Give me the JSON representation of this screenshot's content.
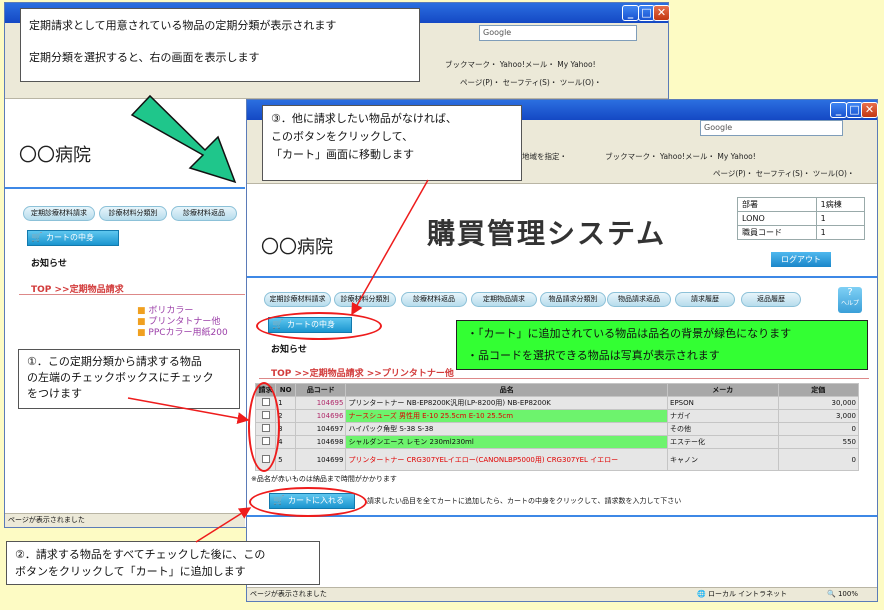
{
  "notes": {
    "top_line1": "定期請求として用意されている物品の定期分類が表示されます",
    "top_line2": "定期分類を選択すると、右の画面を表示します",
    "step3_line1": "③．他に請求したい物品がなければ、",
    "step3_line2": "このボタンをクリックして、",
    "step3_line3": "「カート」画面に移動します",
    "step1_line1": "①．この定期分類から請求する物品",
    "step1_line2": "の左端のチェックボックスにチェック",
    "step1_line3": "をつけます",
    "step2_line1": "②．請求する物品をすべてチェックした後に、この",
    "step2_line2": "ボタンをクリックして「カート」に追加します",
    "green_line1": "・「カート」に追加されている物品は品名の背景が緑色になります",
    "green_line2": "・品コードを選択できる物品は写真が表示されます"
  },
  "back_window": {
    "google": "Google",
    "bookmarks": "ブックマーク・",
    "yahoo_mail": "Yahoo!メール・",
    "my_yahoo": "My Yahoo!",
    "tools": "ページ(P)・ セーフティ(S)・ ツール(O)・",
    "hospital": "〇〇病院",
    "nav": [
      "定期診療材料請求",
      "診療材料分類別",
      "診療材料返品"
    ],
    "cart_label": "カートの中身",
    "notice": "お知らせ",
    "breadcrumb": "TOP >>定期物品請求",
    "categories": [
      "ボリカラー",
      "プリンタトナー他",
      "PPCカラー用紙200"
    ],
    "status": "ページが表示されました"
  },
  "front_window": {
    "google": "Google",
    "tools_row1": "地域を指定・",
    "bookmarks": "ブックマーク・",
    "yahoo_mail": "Yahoo!メール・",
    "my_yahoo": "My Yahoo!",
    "tools_row2": "ページ(P)・ セーフティ(S)・ ツール(O)・",
    "hospital": "〇〇病院",
    "system_title": "購買管理システム",
    "info": [
      {
        "label": "部署",
        "value": "1病棟"
      },
      {
        "label": "LONO",
        "value": "1"
      },
      {
        "label": "職員コード",
        "value": "1"
      }
    ],
    "logout": "ログアウト",
    "nav": [
      "定期診療材料請求",
      "診療材料分類別",
      "診療材料返品",
      "定期物品請求",
      "物品請求分類別",
      "物品請求返品",
      "請求履歴",
      "返品履歴"
    ],
    "help": "ヘルプ",
    "cart_label": "カートの中身",
    "notice": "お知らせ",
    "breadcrumb": "TOP >>定期物品請求 >>プリンタトナー他",
    "table_headers": [
      "請求",
      "NO",
      "品コード",
      "品名",
      "メーカ",
      "定価"
    ],
    "rows": [
      {
        "no": "1",
        "code": "104695",
        "name": "プリンタートナー NB-EP8200K汎用(LP-8200用) NB-EP8200K",
        "maker": "EPSON",
        "price": "30,000"
      },
      {
        "no": "2",
        "code": "104696",
        "name": "ナースシューズ 男性用 E-10 25.5cm E-10 25.5cm",
        "maker": "ナガイ",
        "price": "3,000"
      },
      {
        "no": "3",
        "code": "104697",
        "name": "ハイパック角型 S-38 S-38",
        "maker": "その他",
        "price": "0"
      },
      {
        "no": "4",
        "code": "104698",
        "name": "シャルダンエース レモン 230ml230ml",
        "maker": "エステー化",
        "price": "550"
      },
      {
        "no": "5",
        "code": "104699",
        "name": "プリンタートナー CRG307YELイエロー(CANONLBP5000用) CRG307YEL イエロー",
        "maker": "キャノン",
        "price": "0"
      }
    ],
    "note_red_items": "※品名が赤いものは納品まで時間がかかります",
    "add_to_cart": "カートに入れる",
    "add_help": "請求したい品目を全てカートに追加したら、カートの中身をクリックして、請求数を入力して下さい",
    "status": "ページが表示されました",
    "zone": "ローカル イントラネット",
    "zoom": "100%"
  }
}
